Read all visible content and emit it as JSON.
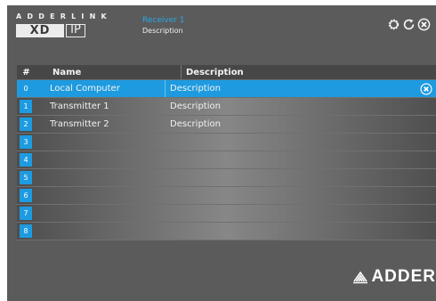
{
  "header": {
    "brand_line": "ADDERLINK",
    "product_xd": "XD",
    "product_ip": "IP",
    "receiver_title": "Receiver 1",
    "receiver_description": "Description"
  },
  "toolbar": {
    "icons": [
      "gear-icon",
      "refresh-icon",
      "close-icon"
    ]
  },
  "table": {
    "columns": {
      "num": "#",
      "name": "Name",
      "description": "Description"
    },
    "rows": [
      {
        "num": "0",
        "name": "Local Computer",
        "description": "Description",
        "selected": true
      },
      {
        "num": "1",
        "name": "Transmitter 1",
        "description": "Description"
      },
      {
        "num": "2",
        "name": "Transmitter 2",
        "description": "Description"
      },
      {
        "num": "3",
        "name": "",
        "description": ""
      },
      {
        "num": "4",
        "name": "",
        "description": ""
      },
      {
        "num": "5",
        "name": "",
        "description": ""
      },
      {
        "num": "6",
        "name": "",
        "description": ""
      },
      {
        "num": "7",
        "name": "",
        "description": ""
      },
      {
        "num": "8",
        "name": "",
        "description": ""
      }
    ]
  },
  "footer": {
    "brand": "ADDER"
  },
  "colors": {
    "accent": "#1e9be0",
    "background": "#5b5b5b",
    "receiver_title": "#2aa7e6"
  }
}
